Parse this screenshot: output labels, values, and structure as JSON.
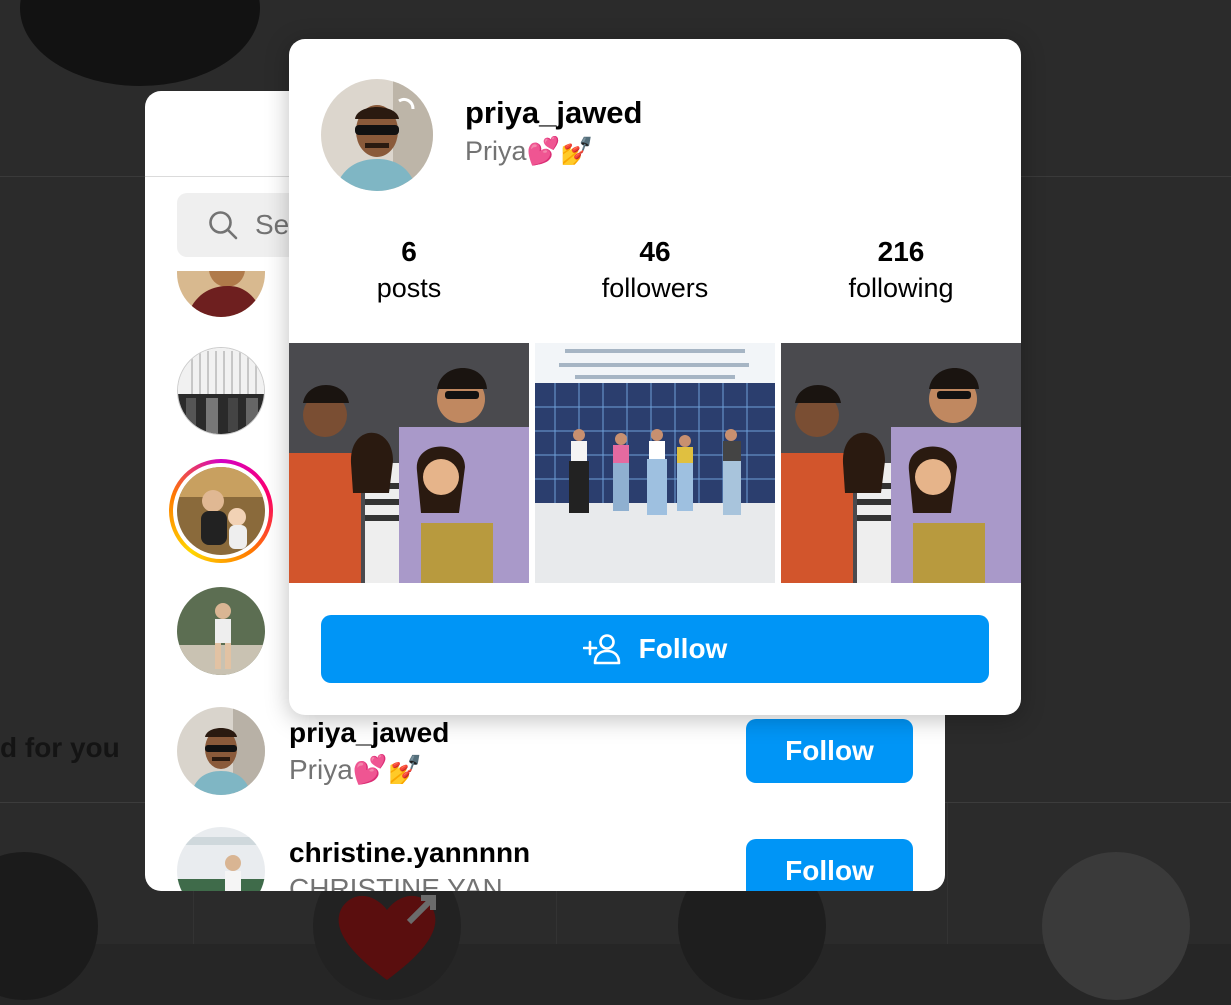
{
  "background": {
    "suggested_heading": "d for you"
  },
  "dialog": {
    "search": {
      "placeholder": "Search"
    },
    "rows": [
      {
        "username": "priya_jawed",
        "full_name": "Priya💕💅",
        "follow_label": "Follow"
      },
      {
        "username": "christine.yannnnn",
        "full_name": "CHRISTINE YAN",
        "follow_label": "Follow"
      }
    ]
  },
  "hover_card": {
    "username": "priya_jawed",
    "full_name": "Priya💕💅",
    "stats": [
      {
        "value": "6",
        "label": "posts"
      },
      {
        "value": "46",
        "label": "followers"
      },
      {
        "value": "216",
        "label": "following"
      }
    ],
    "follow_label": "Follow"
  },
  "colors": {
    "accent": "#0095f6",
    "overlay": "#262626",
    "secondary_text": "#737373"
  },
  "icons": [
    "search-icon",
    "add-person-icon"
  ]
}
